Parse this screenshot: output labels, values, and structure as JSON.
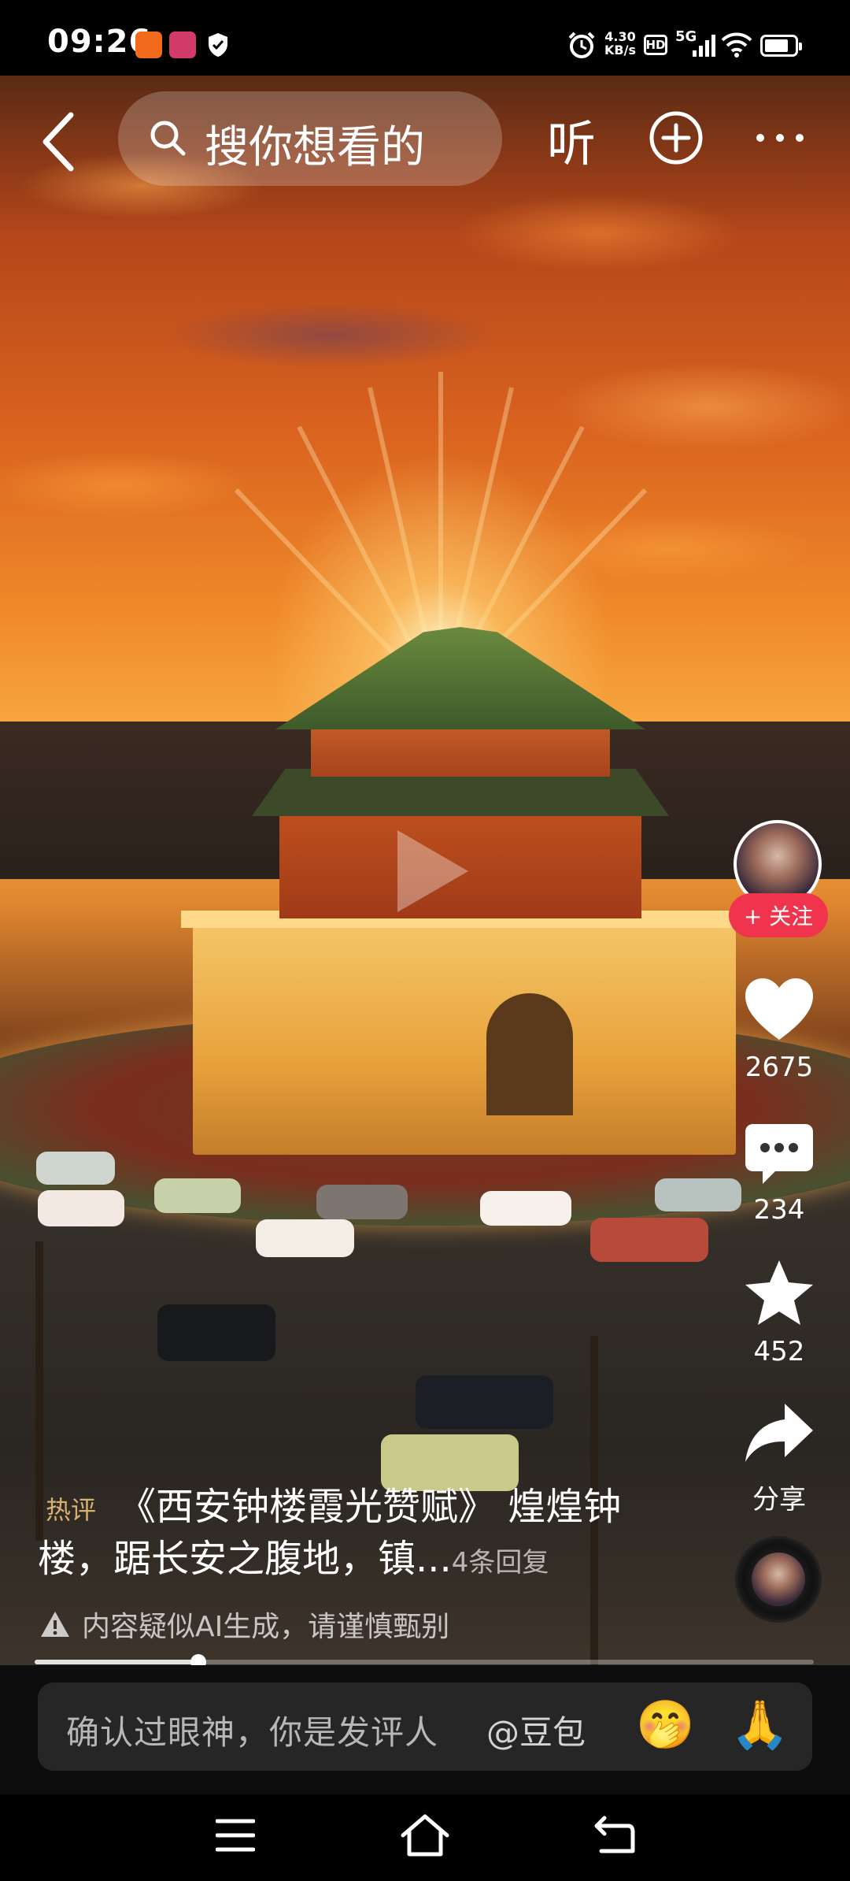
{
  "status_bar": {
    "time": "09:26",
    "net_speed_value": "4.30",
    "net_speed_unit": "KB/s",
    "hd_label": "HD",
    "network": "5G",
    "battery_level": 0.8
  },
  "top_bar": {
    "search_placeholder": "搜你想看的",
    "listen_label": "听"
  },
  "right_rail": {
    "follow_label": "+ 关注",
    "like_count": "2675",
    "comment_count": "234",
    "favorite_count": "452",
    "share_label": "分享"
  },
  "caption": {
    "hot_label": "热评",
    "line1": "《西安钟楼霞光赞赋》 煌煌钟",
    "line2": "楼，踞长安之腹地，镇...",
    "replies": "4条回复"
  },
  "ai_warning": "内容疑似AI生成，请谨慎甄别",
  "progress": 0.21,
  "comment_bar": {
    "placeholder": "确认过眼神，你是发评人",
    "mention": "@豆包",
    "emoji_1": "🤭",
    "emoji_2": "🙏"
  },
  "colors": {
    "follow_bg": "#f0344d",
    "hot_label": "#d8b071"
  },
  "icons": [
    "back-icon",
    "search-icon",
    "add-icon",
    "more-icon",
    "heart-icon",
    "comment-icon",
    "star-icon",
    "share-icon",
    "warning-icon",
    "menu-icon",
    "home-icon",
    "back-nav-icon"
  ]
}
